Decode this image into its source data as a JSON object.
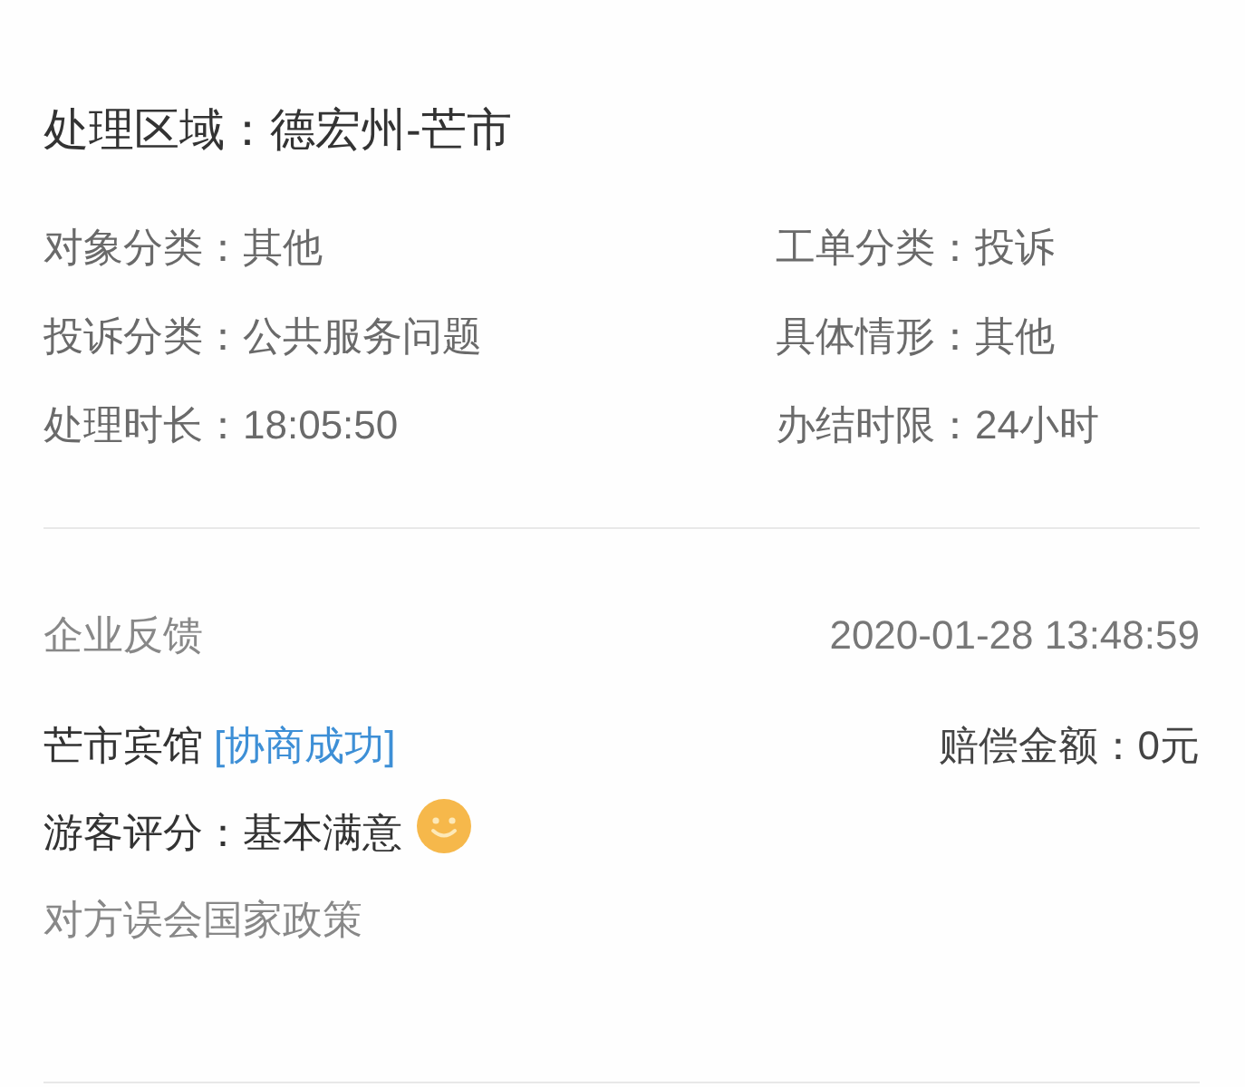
{
  "region": "处理区域：德宏州-芒市",
  "details": [
    "对象分类：其他",
    "工单分类：投诉",
    "投诉分类：公共服务问题",
    "具体情形：其他",
    "处理时长：18:05:50",
    "办结时限：24小时"
  ],
  "feedback": {
    "title": "企业反馈",
    "time": "2020-01-28 13:48:59",
    "merchant": "芒市宾馆",
    "status": "[协商成功]",
    "compensation": "赔偿金额：0元",
    "rating": "游客评分：基本满意",
    "comment": "对方误会国家政策"
  }
}
